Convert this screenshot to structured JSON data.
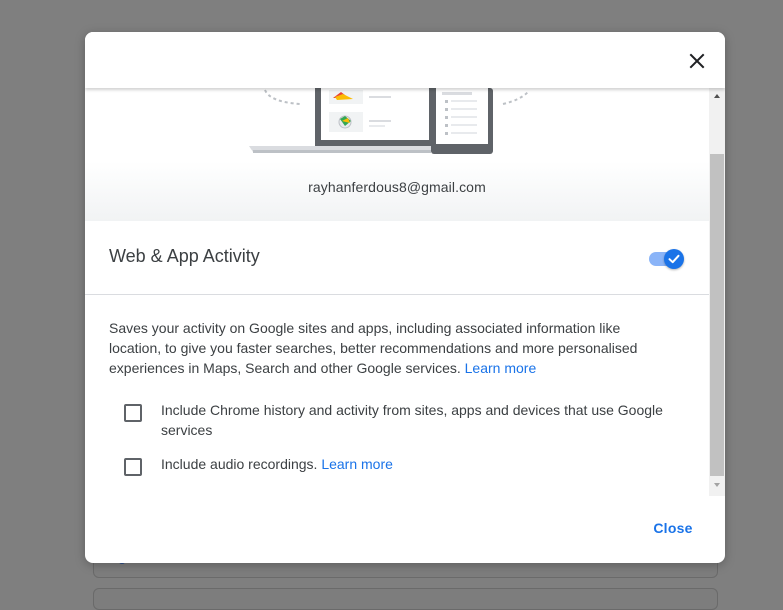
{
  "dialog": {
    "close_icon": "close-icon",
    "account_email": "rayhanferdous8@gmail.com",
    "setting": {
      "title": "Web & App Activity",
      "enabled": true
    },
    "description": {
      "text": "Saves your activity on Google sites and apps, including associated information like location, to give you faster searches, better recommendations and more personalised experiences in Maps, Search and other Google services.",
      "link": "Learn more"
    },
    "options": [
      {
        "label": "Include Chrome history and activity from sites, apps and devices that use Google services",
        "checked": false
      },
      {
        "label": "Include audio recordings.",
        "link": "Learn more",
        "checked": false
      }
    ],
    "close_button": "Close"
  },
  "colors": {
    "accent": "#1a73e8",
    "toggle_track": "#8ab4f8",
    "overlay": "#7f7f7f",
    "text": "#3c4043"
  }
}
